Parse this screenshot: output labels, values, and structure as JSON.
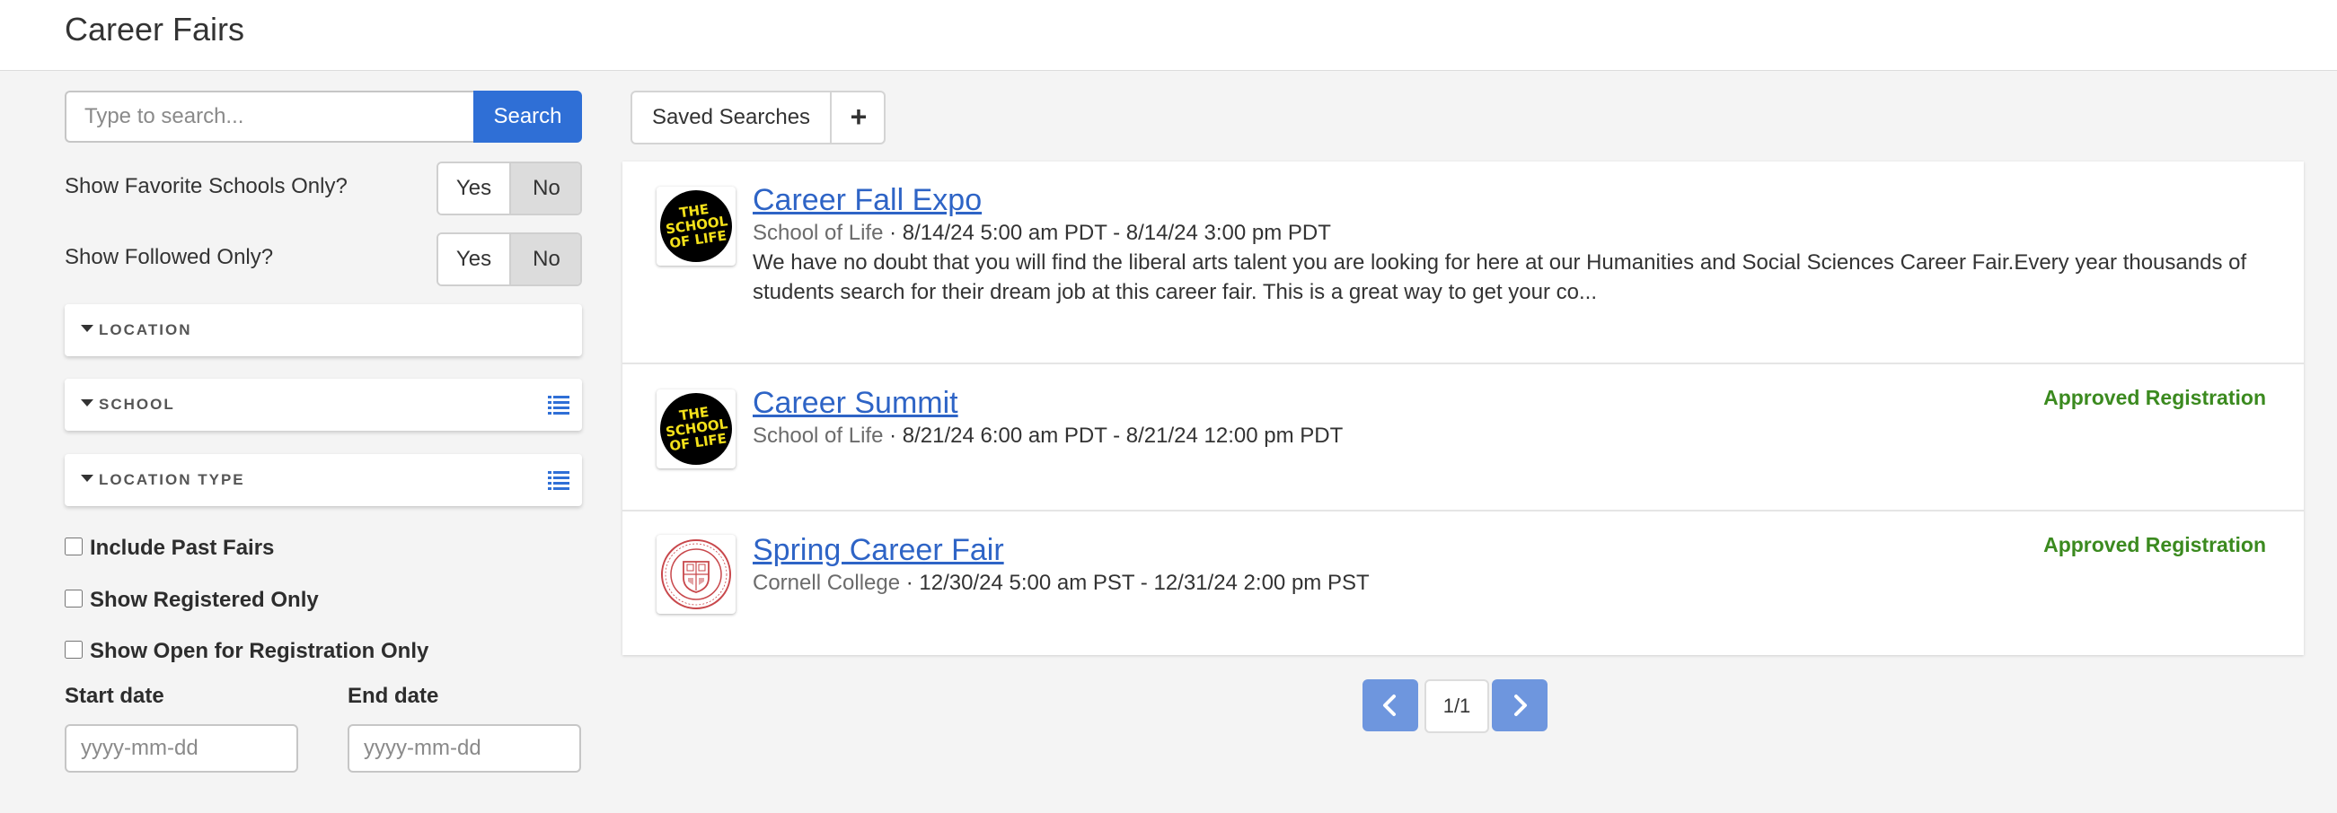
{
  "header": {
    "title": "Career Fairs"
  },
  "search": {
    "placeholder": "Type to search...",
    "button_label": "Search"
  },
  "filters": {
    "favorite_schools": {
      "label": "Show Favorite Schools Only?",
      "yes": "Yes",
      "no": "No",
      "selected": "No"
    },
    "followed": {
      "label": "Show Followed Only?",
      "yes": "Yes",
      "no": "No",
      "selected": "No"
    },
    "location": {
      "label": "LOCATION"
    },
    "school": {
      "label": "SCHOOL"
    },
    "location_type": {
      "label": "LOCATION TYPE"
    },
    "include_past": {
      "label": "Include Past Fairs",
      "checked": false
    },
    "registered_only": {
      "label": "Show Registered Only",
      "checked": false
    },
    "open_only": {
      "label": "Show Open for Registration Only",
      "checked": false
    },
    "start_date": {
      "label": "Start date",
      "placeholder": "yyyy-mm-dd"
    },
    "end_date": {
      "label": "End date",
      "placeholder": "yyyy-mm-dd"
    }
  },
  "toolbar": {
    "saved_searches": "Saved Searches",
    "add": "+"
  },
  "results": [
    {
      "title": "Career Fall Expo",
      "school": "School of Life",
      "dates": " · 8/14/24 5:00 am PDT - 8/14/24 3:00 pm PDT",
      "description": "We have no doubt that you will find the liberal arts talent you are looking for here at our Humanities and Social Sciences Career Fair.Every year thousands of students search for their dream job at this career fair. This is a great way to get your co...",
      "status": "",
      "logo_text": "THE SCHOOL OF LIFE"
    },
    {
      "title": "Career Summit",
      "school": "School of Life",
      "dates": " · 8/21/24 6:00 am PDT - 8/21/24 12:00 pm PDT",
      "description": "",
      "status": "Approved Registration",
      "logo_text": "THE SCHOOL OF LIFE"
    },
    {
      "title": "Spring Career Fair",
      "school": "Cornell College",
      "dates": " · 12/30/24 5:00 am PST - 12/31/24 2:00 pm PST",
      "description": "",
      "status": "Approved Registration",
      "logo_text": ""
    }
  ],
  "pagination": {
    "page": "1/1"
  },
  "colors": {
    "accent": "#2f6fd6",
    "link": "#2e64c6",
    "approved": "#3b8a1f",
    "pager": "#6e96de"
  }
}
